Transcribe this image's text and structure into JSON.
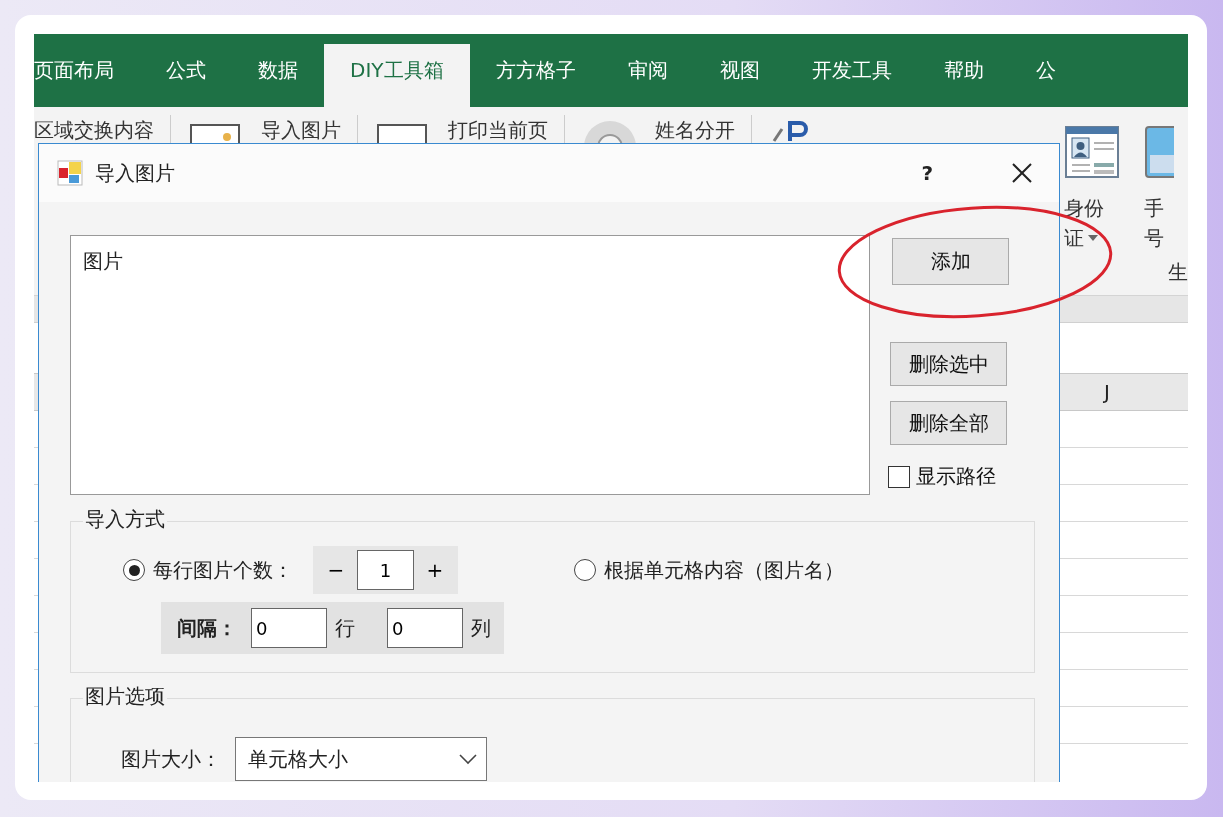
{
  "ribbon": {
    "tabs": [
      {
        "label": "页面布局",
        "selected": false
      },
      {
        "label": "公式",
        "selected": false
      },
      {
        "label": "数据",
        "selected": false
      },
      {
        "label": "DIY工具箱",
        "selected": true
      },
      {
        "label": "方方格子",
        "selected": false
      },
      {
        "label": "审阅",
        "selected": false
      },
      {
        "label": "视图",
        "selected": false
      },
      {
        "label": "开发工具",
        "selected": false
      },
      {
        "label": "帮助",
        "selected": false
      },
      {
        "label": "公",
        "selected": false
      }
    ],
    "commands": [
      {
        "label": "区域交换内容"
      },
      {
        "label": "导入图片"
      },
      {
        "label": "打印当前页"
      },
      {
        "label": "姓名分开"
      }
    ],
    "right_commands": [
      {
        "lines": [
          "身份",
          "证"
        ],
        "dropdown": true
      },
      {
        "lines": [
          "手",
          "号"
        ],
        "dropdown": false
      }
    ],
    "group_label": "生"
  },
  "sheet": {
    "column_header": "J"
  },
  "dialog": {
    "title": "导入图片",
    "help": "?",
    "list": {
      "header": "图片"
    },
    "buttons": [
      {
        "label": "添加"
      },
      {
        "label": "删除选中"
      },
      {
        "label": "删除全部"
      }
    ],
    "show_path": {
      "label": "显示路径",
      "checked": false
    },
    "import_mode": {
      "title": "导入方式",
      "options": [
        {
          "label": "每行图片个数：",
          "selected": true
        },
        {
          "label": "根据单元格内容（图片名）",
          "selected": false
        }
      ],
      "count": {
        "minus": "−",
        "value": "1",
        "plus": "+"
      },
      "spacing": {
        "label": "间隔：",
        "rows_value": "0",
        "rows_unit": "行",
        "cols_value": "0",
        "cols_unit": "列"
      }
    },
    "picture_options": {
      "title": "图片选项",
      "size_label": "图片大小：",
      "size_value": "单元格大小"
    }
  }
}
